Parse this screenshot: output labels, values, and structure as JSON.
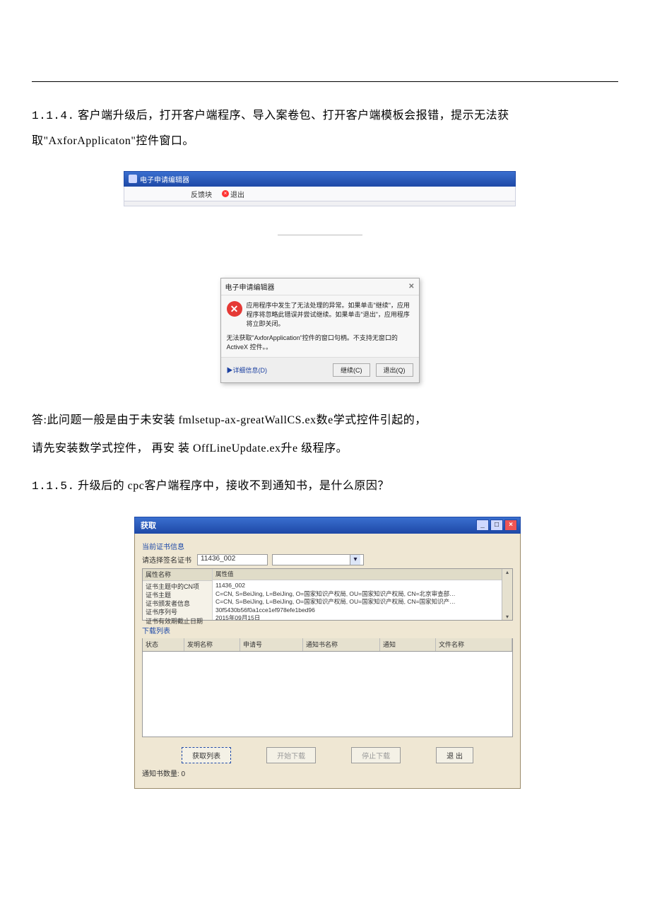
{
  "section114": {
    "number": "1.1.4.",
    "text": "客户端升级后，打开客户端程序、导入案卷包、打开客户端模板会报错，提示无法获取\"AxforApplicaton\"控件窗口。"
  },
  "shot1": {
    "title": "电子申请编辑器",
    "toolbar": {
      "btn1": "反馈块",
      "btn2": "退出"
    }
  },
  "errDialog": {
    "title": "电子申请编辑器",
    "close": "✕",
    "msg1": "应用程序中发生了无法处理的异常。如果单击\"继续\"，应用程序将忽略此错误并尝试继续。如果单击\"退出\"，应用程序将立即关闭。",
    "msg2": "无法获取\"AxforApplication\"控件的窗口句柄。不支持无窗口的 ActiveX 控件。。",
    "detailsLink": "▶详细信息(D)",
    "continueBtn": "继续(C)",
    "quitBtn": "退出(Q)"
  },
  "answer": {
    "line1": "答:此问题一般是由于未安装 fmlsetup-ax-greatWallCS.ex数e学式控件引起的，",
    "line2": "请先安装数学式控件，  再安 装 OffLineUpdate.ex升e 级程序。"
  },
  "section115": {
    "number": "1.1.5.",
    "text": "升级后的 cpc客户端程序中，接收不到通知书，是什么原因？"
  },
  "shot2": {
    "winTitle": "获取",
    "headingCert": "当前证书信息",
    "labelChooseCert": "请选择签名证书",
    "certValue": "11436_002",
    "attrHead": "属性名称",
    "valHead": "属性值",
    "attrs": {
      "a1": "证书主题中的CN项",
      "a2": "证书主题",
      "a3": "证书颁发者信息",
      "a4": "证书序列号",
      "a5": "证书有效期截止日期"
    },
    "vals": {
      "v1": "11436_002",
      "v2": "C=CN, S=BeiJing, L=BeiJing, O=国家知识产权局, OU=国家知识产权局, CN=北京审查部…",
      "v3": "C=CN, S=BeiJing, L=BeiJing, O=国家知识产权局, OU=国家知识产权局, CN=国家知识产…",
      "v4": "30f5430b56f0a1cce1ef978efe1bed96",
      "v5": "2015年09月15日"
    },
    "listHeading": "下载列表",
    "cols": {
      "c1": "状态",
      "c2": "发明名称",
      "c3": "申请号",
      "c4": "通知书名称",
      "c5": "通知",
      "c6": "文件名称"
    },
    "btns": {
      "b1": "获取列表",
      "b2": "开始下载",
      "b3": "停止下载",
      "b4": "退 出"
    },
    "countLabel": "通知书数量: 0"
  }
}
